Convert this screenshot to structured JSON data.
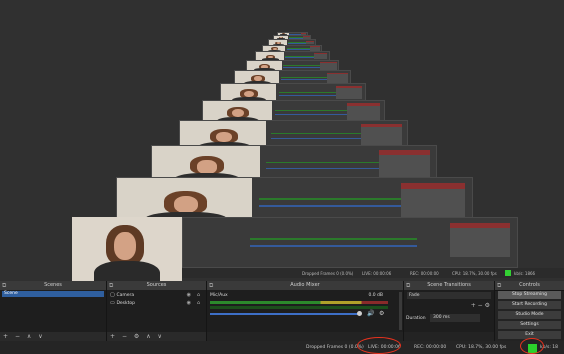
{
  "preview": {
    "status": {
      "dropped": "Dropped Frames 0 (0.0%)",
      "live": "LIVE: 00:00:06",
      "rec": "REC: 00:00:00",
      "cpu": "CPU: 18.7%, 30.00 fps",
      "kbps": "kb/s: 1866"
    }
  },
  "docks": {
    "scenes": {
      "title": "Scenes",
      "items": [
        "Scene"
      ],
      "footer": [
        "+",
        "−",
        "∧",
        "∨"
      ]
    },
    "sources": {
      "title": "Sources",
      "items": [
        {
          "icon": "▢",
          "label": "Camera"
        },
        {
          "icon": "▭",
          "label": "Desktop"
        }
      ],
      "footer": [
        "+",
        "−",
        "⚙",
        "∧",
        "∨"
      ]
    },
    "mixer": {
      "title": "Audio Mixer",
      "channel": "Mic/Aux",
      "db": "0.0 dB"
    },
    "transitions": {
      "title": "Scene Transitions",
      "type": "Fade",
      "duration_label": "Duration",
      "duration": "300 ms"
    },
    "controls": {
      "title": "Controls",
      "buttons": [
        "Stop Streaming",
        "Start Recording",
        "Studio Mode",
        "Settings",
        "Exit"
      ]
    }
  },
  "statusbar": {
    "dropped": "Dropped Frames 0 (0.0%)",
    "live": "LIVE: 00:00:06",
    "rec": "REC: 00:00:00",
    "cpu": "CPU: 18.7%, 30.00 fps",
    "kbps": "kb/s: 18"
  },
  "colors": {
    "accent": "#2f5f9f",
    "live_indicator": "#2bd12b",
    "annotation": "#e8321e"
  },
  "icons": {
    "pin": "dock-pin-icon",
    "eye": "eye-icon",
    "lock": "lock-icon",
    "volume": "volume-icon",
    "gear": "gear-icon"
  }
}
